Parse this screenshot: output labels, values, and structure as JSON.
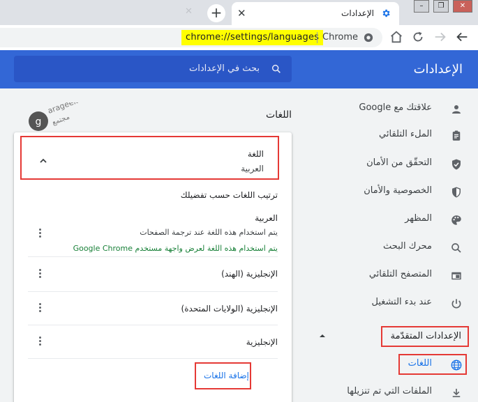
{
  "browser": {
    "tab_title": "الإعدادات",
    "url": "chrome://settings/languages",
    "chip_label": "Chrome"
  },
  "settings": {
    "header_title": "الإعدادات",
    "search_placeholder": "بحث في الإعدادات"
  },
  "watermark": {
    "brand_latin": "arageek",
    "brand_arabic": "مجتمع"
  },
  "sidebar": {
    "items": [
      {
        "label": "علاقتك مع Google",
        "icon": "person-icon"
      },
      {
        "label": "الملء التلقائي",
        "icon": "clipboard-icon"
      },
      {
        "label": "التحقّق من الأمان",
        "icon": "shield-check-icon"
      },
      {
        "label": "الخصوصية والأمان",
        "icon": "shield-icon"
      },
      {
        "label": "المظهر",
        "icon": "palette-icon"
      },
      {
        "label": "محرك البحث",
        "icon": "search-icon"
      },
      {
        "label": "المتصفح التلقائي",
        "icon": "browser-icon"
      },
      {
        "label": "عند بدء التشغيل",
        "icon": "power-icon"
      }
    ],
    "advanced_label": "الإعدادات المتقدّمة",
    "languages_label": "اللغات",
    "downloads_label": "الملفات التي تم تنزيلها"
  },
  "main": {
    "section_title": "اللغات",
    "language_header": {
      "label": "اللغة",
      "value": "العربية"
    },
    "order_title": "ترتيب اللغات حسب تفضيلك",
    "languages": [
      {
        "name": "العربية",
        "sub1": "يتم استخدام هذه اللغة عند ترجمة الصفحات",
        "sub2": "يتم استخدام هذه اللغة لعرض واجهة مستخدم Google Chrome"
      },
      {
        "name": "الإنجليزية (الهند)"
      },
      {
        "name": "الإنجليزية (الولايات المتحدة)"
      },
      {
        "name": "الإنجليزية"
      }
    ],
    "add_languages": "إضافة اللغات"
  },
  "colors": {
    "accent": "#3367d6",
    "link": "#1a73e8",
    "highlight": "#ffff00",
    "annotation": "#e53935",
    "status_green": "#188038"
  }
}
